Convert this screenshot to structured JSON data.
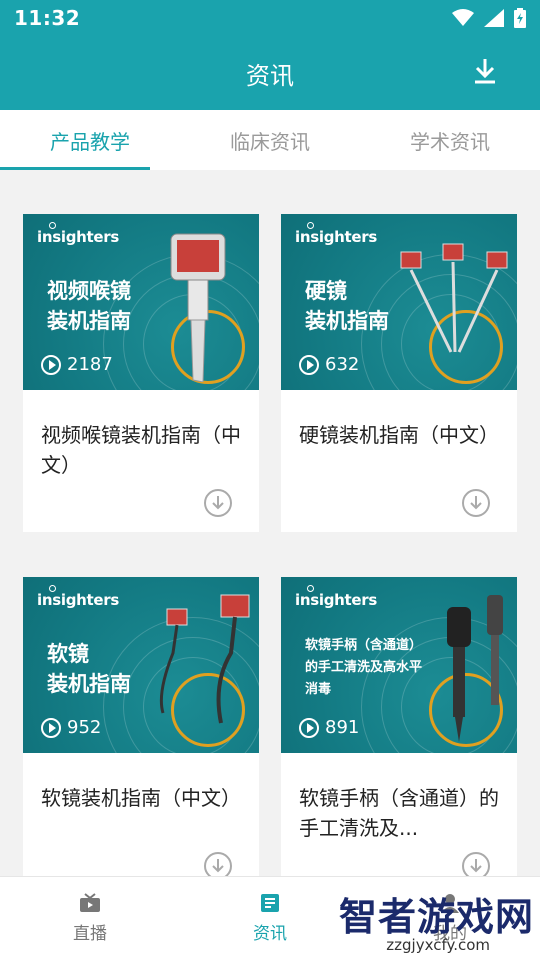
{
  "status": {
    "time": "11:32"
  },
  "header": {
    "title": "资讯"
  },
  "tabs": [
    {
      "label": "产品教学",
      "active": true
    },
    {
      "label": "临床资讯",
      "active": false
    },
    {
      "label": "学术资讯",
      "active": false
    }
  ],
  "cards": [
    {
      "brand": "insighters",
      "banner_title": "视频喉镜\n装机指南",
      "views": "2187",
      "title": "视频喉镜装机指南（中文）"
    },
    {
      "brand": "insighters",
      "banner_title": "硬镜\n装机指南",
      "views": "632",
      "title": "硬镜装机指南（中文）"
    },
    {
      "brand": "insighters",
      "banner_title": "软镜\n装机指南",
      "views": "952",
      "title": "软镜装机指南（中文）"
    },
    {
      "brand": "insighters",
      "banner_title": "软镜手柄（含通道）\n的手工清洗及高水平\n消毒",
      "views": "891",
      "title": "软镜手柄（含通道）的手工清洗及..."
    }
  ],
  "bottom_nav": [
    {
      "label": "直播",
      "icon": "tv-icon"
    },
    {
      "label": "资讯",
      "icon": "article-icon",
      "active": true
    },
    {
      "label": "我的",
      "icon": "user-icon"
    }
  ],
  "watermark": {
    "text": "智者游戏网",
    "sub": "zzgjyxcfy.com"
  },
  "colors": {
    "accent": "#1aa3ad",
    "banner": "#137a83",
    "gold": "#e0a020"
  }
}
